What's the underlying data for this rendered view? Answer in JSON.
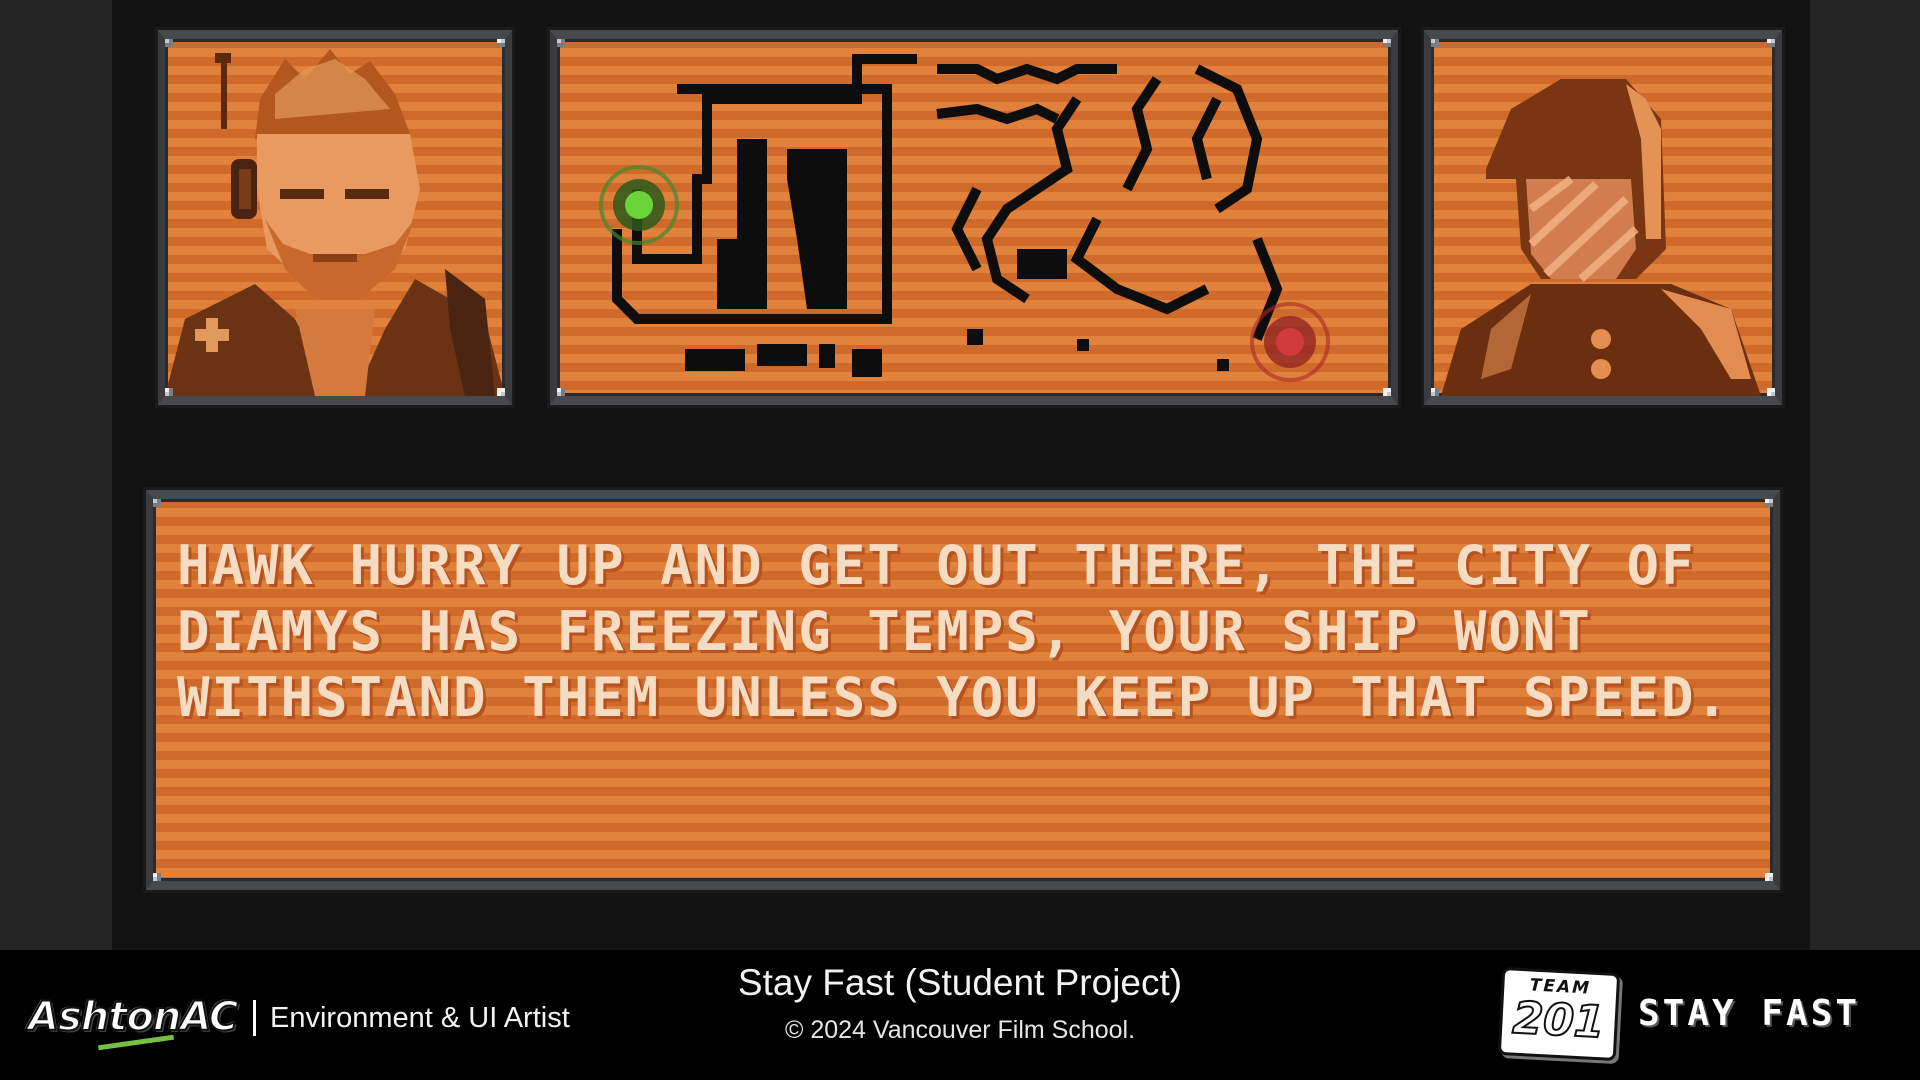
{
  "dialogue": {
    "text": "HAWK HURRY UP AND GET OUT THERE, THE CITY OF DIAMYS HAS FREEZING TEMPS, YOUR SHIP WONT WITHSTAND THEM UNLESS YOU KEEP UP THAT SPEED."
  },
  "panels": {
    "left_portrait": "pilot-portrait-icon",
    "map": "route-map-icon",
    "right_portrait": "helmeted-officer-icon",
    "start_marker": "green-start-marker-icon",
    "end_marker": "red-destination-marker-icon"
  },
  "colors": {
    "panel_stripe_dark": "#cf6a2b",
    "panel_stripe_light": "#e0813c",
    "frame": "#47494d",
    "text": "#f7dcc4",
    "start_marker": "#6bd43a",
    "end_marker": "#d23b3b"
  },
  "footer": {
    "artist_name": "AshtonAC",
    "role": "Environment & UI Artist",
    "title": "Stay Fast (Student Project)",
    "copyright": "© 2024 Vancouver Film School.",
    "team_label": "TEAM",
    "team_number": "201",
    "game_logo": "STAY FAST"
  }
}
